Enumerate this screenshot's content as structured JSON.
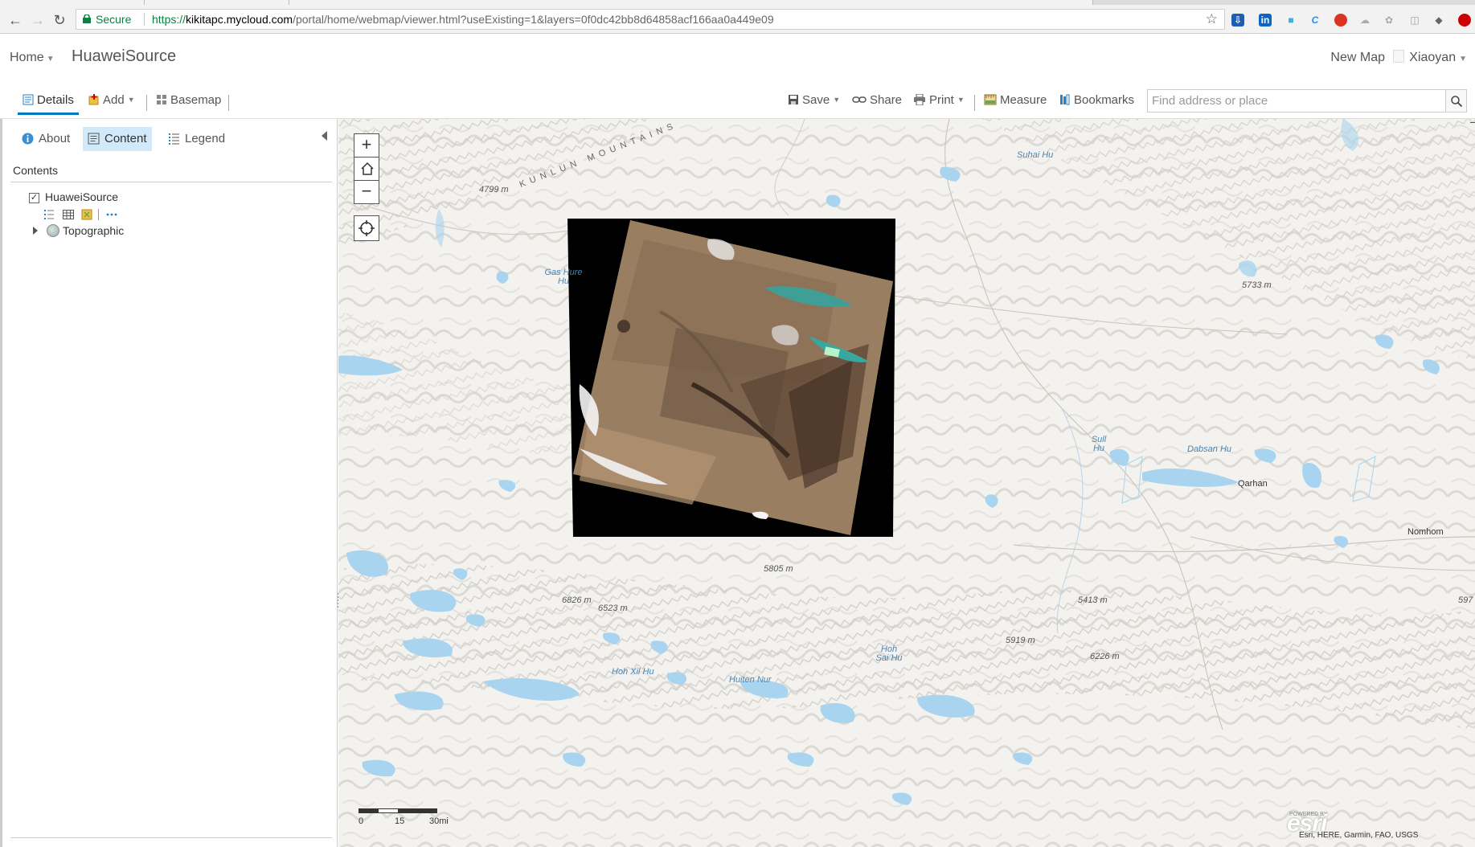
{
  "browser": {
    "secure_label": "Secure",
    "url_scheme": "https://",
    "url_domain": "kikitapc.mycloud.com",
    "url_path": "/portal/home/webmap/viewer.html?useExisting=1&layers=0f0dc42bb8d64858acf166aa0a449e09"
  },
  "header": {
    "home_label": "Home",
    "map_title": "HuaweiSource",
    "new_map_label": "New Map",
    "user_name": "Xiaoyan"
  },
  "toolbar": {
    "details_label": "Details",
    "add_label": "Add",
    "basemap_label": "Basemap",
    "save_label": "Save",
    "share_label": "Share",
    "print_label": "Print",
    "measure_label": "Measure",
    "bookmarks_label": "Bookmarks",
    "search_placeholder": "Find address or place"
  },
  "panel": {
    "tabs": {
      "about": "About",
      "content": "Content",
      "legend": "Legend"
    },
    "contents_heading": "Contents",
    "layers": [
      {
        "name": "HuaweiSource",
        "checked": true
      },
      {
        "name": "Topographic"
      }
    ]
  },
  "map": {
    "mountain_label": "KUNLUN MOUNTAINS",
    "elevations": [
      "4799 m",
      "5733 m",
      "5805 m",
      "6826 m",
      "6523 m",
      "5413 m",
      "5919 m",
      "6226 m",
      "597"
    ],
    "water": [
      "Suhai Hu",
      "Gas Hure Hu",
      "Sull Hu",
      "Dabsan Hu",
      "Hoh Sai Hu",
      "Hoh Xil Hu",
      "Huiten Nur"
    ],
    "towns": [
      "Qarhan",
      "Nomhom"
    ],
    "scale": {
      "ticks": [
        "0",
        "15",
        "30mi"
      ]
    },
    "attribution": "Esri, HERE, Garmin, FAO, USGS",
    "logo_text": "esri",
    "powered_by": "POWERED BY"
  }
}
